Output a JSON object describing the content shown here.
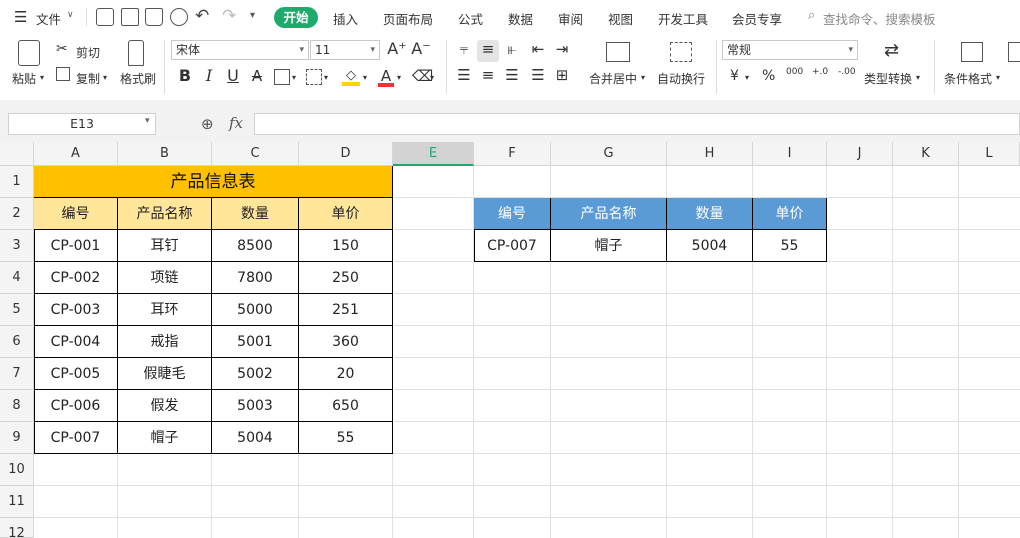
{
  "menu": {
    "file": "文件",
    "tabs": [
      "开始",
      "插入",
      "页面布局",
      "公式",
      "数据",
      "审阅",
      "视图",
      "开发工具",
      "会员专享"
    ],
    "search": "查找命令、搜索模板"
  },
  "ribbon": {
    "paste": "粘贴",
    "cut": "剪切",
    "copy": "复制",
    "format_painter": "格式刷",
    "font_name": "宋体",
    "font_size": "11",
    "merge_center": "合并居中",
    "auto_wrap": "自动换行",
    "number_format": "常规",
    "currency": "¥",
    "percent": "%",
    "thousands": "000",
    "inc_decimal": "+.0",
    "dec_decimal": "-.00",
    "type_convert": "类型转换",
    "cond_format": "条件格式",
    "bold": "B",
    "italic": "I",
    "underline": "U"
  },
  "formula_bar": {
    "cell_ref": "E13",
    "fx": "fx",
    "content": ""
  },
  "columns": [
    "A",
    "B",
    "C",
    "D",
    "E",
    "F",
    "G",
    "H",
    "I",
    "J",
    "K",
    "L"
  ],
  "rows": [
    "1",
    "2",
    "3",
    "4",
    "5",
    "6",
    "7",
    "8",
    "9",
    "10",
    "11",
    "12"
  ],
  "table1": {
    "title": "产品信息表",
    "headers": [
      "编号",
      "产品名称",
      "数量",
      "单价"
    ],
    "rows": [
      [
        "CP-001",
        "耳钉",
        "8500",
        "150"
      ],
      [
        "CP-002",
        "项链",
        "7800",
        "250"
      ],
      [
        "CP-003",
        "耳环",
        "5000",
        "251"
      ],
      [
        "CP-004",
        "戒指",
        "5001",
        "360"
      ],
      [
        "CP-005",
        "假睫毛",
        "5002",
        "20"
      ],
      [
        "CP-006",
        "假发",
        "5003",
        "650"
      ],
      [
        "CP-007",
        "帽子",
        "5004",
        "55"
      ]
    ]
  },
  "table2": {
    "headers": [
      "编号",
      "产品名称",
      "数量",
      "单价"
    ],
    "row": [
      "CP-007",
      "帽子",
      "5004",
      "55"
    ]
  },
  "colors": {
    "accent": "#1faa6d",
    "title_fill": "#ffc000",
    "header_fill": "#ffe699",
    "table2_header": "#5b9bd5"
  }
}
